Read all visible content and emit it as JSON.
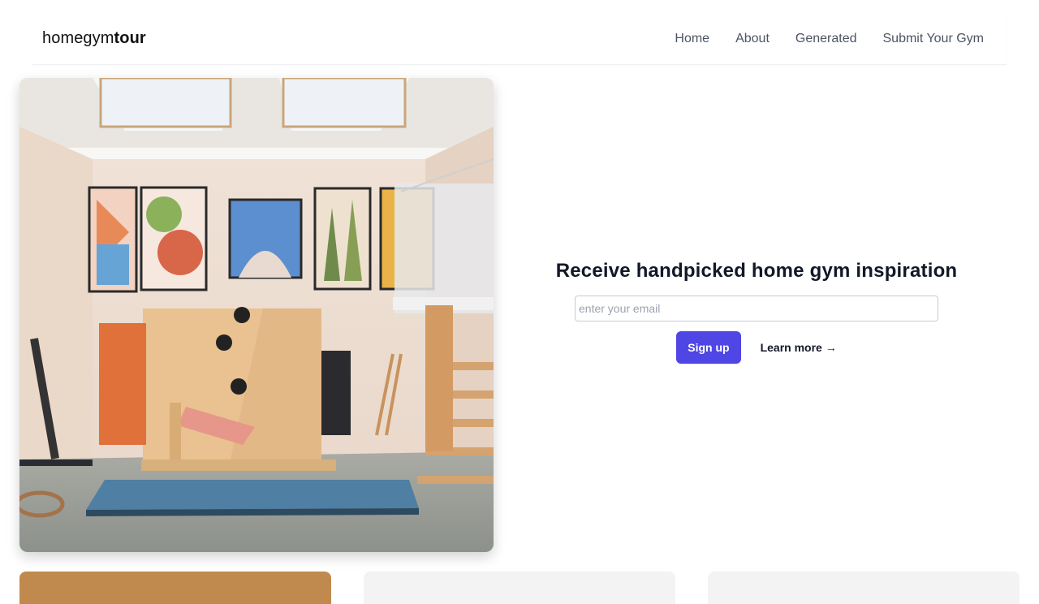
{
  "nav": {
    "logo_light": "homegym",
    "logo_bold": "tour",
    "links": [
      "Home",
      "About",
      "Generated",
      "Submit Your Gym"
    ]
  },
  "hero": {
    "heading": "Receive handpicked home gym inspiration",
    "email_placeholder": "enter your email",
    "signup_label": "Sign up",
    "learn_more_label": "Learn more →"
  },
  "colors": {
    "accent": "#4f46e5",
    "heading": "#111827",
    "nav_link": "#4b5563"
  }
}
